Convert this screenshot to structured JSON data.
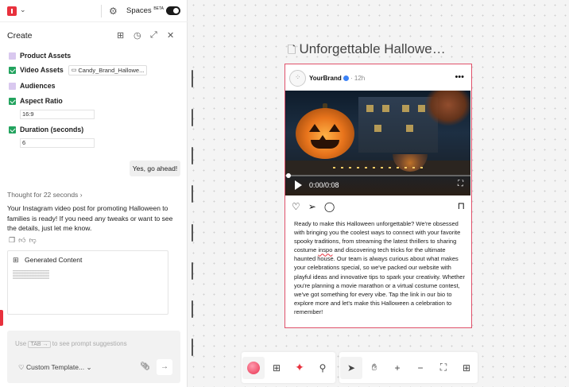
{
  "topbar": {
    "spaces_label": "Spaces",
    "beta_label": "BETA"
  },
  "create": {
    "title": "Create",
    "assets": [
      {
        "label": "Product Assets"
      },
      {
        "label": "Video Assets",
        "chip": "Candy_Brand_Hallowe..."
      },
      {
        "label": "Audiences"
      },
      {
        "label": "Aspect Ratio",
        "value": "16:9"
      },
      {
        "label": "Duration (seconds)",
        "value": "6"
      }
    ]
  },
  "chat": {
    "user_message": "Yes, go ahead!",
    "thought": "Thought for 22 seconds",
    "reply": "Your Instagram video post for promoting Halloween to families is ready! If you need any tweaks or want to see the details, just let me know.",
    "generated_label": "Generated Content"
  },
  "prompt": {
    "placeholder_pre": "Use",
    "kbd": "TAB →",
    "placeholder_post": "to see prompt suggestions",
    "template_label": "Custom Template..."
  },
  "canvas": {
    "doc_title": "Unforgettable Hallowe…",
    "post": {
      "brand": "YourBrand",
      "time": "· 12h",
      "video_time": "0:00/0:08",
      "caption_pre": "Ready to make this Halloween unforgettable? We're obsessed with bringing you the coolest ways to connect with your favorite spooky traditions, from streaming the latest thrillers to sharing costume ",
      "caption_typo": "inspo",
      "caption_post": " and discovering tech tricks for the ultimate haunted house. Our team is always curious about what makes your celebrations special, so we've packed our website with playful ideas and innovative tips to spark your creativity. Whether you're planning a movie marathon or a virtual costume contest, we've got something for every vibe. Tap the link in our bio to explore more and let's make this Halloween a celebration to remember!"
    }
  },
  "colors": {
    "accent": "#e8313d",
    "check": "#22a35e",
    "folder": "#d9c8ef"
  }
}
